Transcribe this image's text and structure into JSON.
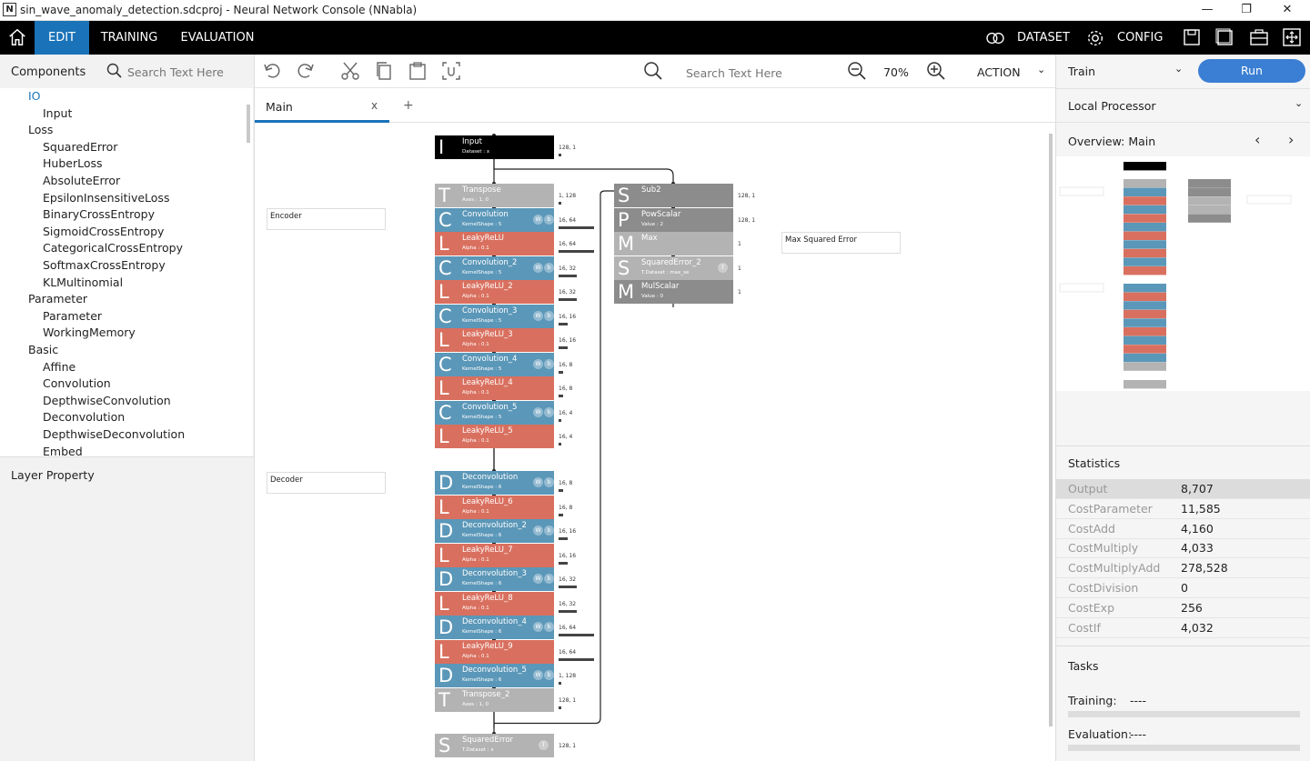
{
  "window": {
    "title": "sin_wave_anomaly_detection.sdcproj - Neural Network Console (NNabla)",
    "app_icon": "N"
  },
  "topbar": {
    "tabs": [
      "EDIT",
      "TRAINING",
      "EVALUATION"
    ],
    "dataset_label": "DATASET",
    "config_label": "CONFIG"
  },
  "left": {
    "components_label": "Components",
    "search_placeholder": "Search Text Here",
    "tree": [
      {
        "label": "IO",
        "level": 0,
        "selected": true
      },
      {
        "label": "Input",
        "level": 1
      },
      {
        "label": "Loss",
        "level": 0
      },
      {
        "label": "SquaredError",
        "level": 1
      },
      {
        "label": "HuberLoss",
        "level": 1
      },
      {
        "label": "AbsoluteError",
        "level": 1
      },
      {
        "label": "EpsilonInsensitiveLoss",
        "level": 1
      },
      {
        "label": "BinaryCrossEntropy",
        "level": 1
      },
      {
        "label": "SigmoidCrossEntropy",
        "level": 1
      },
      {
        "label": "CategoricalCrossEntropy",
        "level": 1
      },
      {
        "label": "SoftmaxCrossEntropy",
        "level": 1
      },
      {
        "label": "KLMultinomial",
        "level": 1
      },
      {
        "label": "Parameter",
        "level": 0
      },
      {
        "label": "Parameter",
        "level": 1
      },
      {
        "label": "WorkingMemory",
        "level": 1
      },
      {
        "label": "Basic",
        "level": 0
      },
      {
        "label": "Affine",
        "level": 1
      },
      {
        "label": "Convolution",
        "level": 1
      },
      {
        "label": "DepthwiseConvolution",
        "level": 1
      },
      {
        "label": "Deconvolution",
        "level": 1
      },
      {
        "label": "DepthwiseDeconvolution",
        "level": 1
      },
      {
        "label": "Embed",
        "level": 1
      }
    ],
    "layer_property_label": "Layer Property"
  },
  "toolbar": {
    "search_placeholder": "Search Text Here",
    "zoom": "70%",
    "action_label": "ACTION"
  },
  "canvas": {
    "tab_main": "Main",
    "tab_close": "x",
    "tab_add": "+",
    "comments": {
      "encoder": "Encoder",
      "decoder": "Decoder",
      "max_se": "Max Squared Error"
    },
    "layers": [
      {
        "icon": "I",
        "name": "Input",
        "param": "Dataset : x",
        "type": "input",
        "size": "128, 1",
        "bar": 0.03
      },
      {
        "icon": "T",
        "name": "Transpose",
        "param": "Axes : 1, 0",
        "type": "gray",
        "size": "1, 128",
        "bar": 0.03
      },
      {
        "icon": "C",
        "name": "Convolution",
        "param": "KernelShape : 5",
        "type": "blue",
        "wb": true,
        "size": "16, 64",
        "bar": 0.6
      },
      {
        "icon": "L",
        "name": "LeakyReLU",
        "param": "Alpha : 0.1",
        "type": "red",
        "size": "16, 64",
        "bar": 0.6
      },
      {
        "icon": "C",
        "name": "Convolution_2",
        "param": "KernelShape : 5",
        "type": "blue",
        "wb": true,
        "size": "16, 32",
        "bar": 0.3
      },
      {
        "icon": "L",
        "name": "LeakyReLU_2",
        "param": "Alpha : 0.1",
        "type": "red",
        "size": "16, 32",
        "bar": 0.3
      },
      {
        "icon": "C",
        "name": "Convolution_3",
        "param": "KernelShape : 5",
        "type": "blue",
        "wb": true,
        "size": "16, 16",
        "bar": 0.15
      },
      {
        "icon": "L",
        "name": "LeakyReLU_3",
        "param": "Alpha : 0.1",
        "type": "red",
        "size": "16, 16",
        "bar": 0.15
      },
      {
        "icon": "C",
        "name": "Convolution_4",
        "param": "KernelShape : 5",
        "type": "blue",
        "wb": true,
        "size": "16, 8",
        "bar": 0.08
      },
      {
        "icon": "L",
        "name": "LeakyReLU_4",
        "param": "Alpha : 0.1",
        "type": "red",
        "size": "16, 8",
        "bar": 0.08
      },
      {
        "icon": "C",
        "name": "Convolution_5",
        "param": "KernelShape : 5",
        "type": "blue",
        "wb": true,
        "size": "16, 4",
        "bar": 0.04
      },
      {
        "icon": "L",
        "name": "LeakyReLU_5",
        "param": "Alpha : 0.1",
        "type": "red",
        "size": "16, 4",
        "bar": 0.04
      },
      {
        "icon": "D",
        "name": "Deconvolution",
        "param": "KernelShape : 6",
        "type": "blue",
        "wb": true,
        "size": "16, 8",
        "bar": 0.08,
        "gap": true
      },
      {
        "icon": "L",
        "name": "LeakyReLU_6",
        "param": "Alpha : 0.1",
        "type": "red",
        "size": "16, 8",
        "bar": 0.08
      },
      {
        "icon": "D",
        "name": "Deconvolution_2",
        "param": "KernelShape : 6",
        "type": "blue",
        "wb": true,
        "size": "16, 16",
        "bar": 0.15
      },
      {
        "icon": "L",
        "name": "LeakyReLU_7",
        "param": "Alpha : 0.1",
        "type": "red",
        "size": "16, 16",
        "bar": 0.15
      },
      {
        "icon": "D",
        "name": "Deconvolution_3",
        "param": "KernelShape : 6",
        "type": "blue",
        "wb": true,
        "size": "16, 32",
        "bar": 0.3
      },
      {
        "icon": "L",
        "name": "LeakyReLU_8",
        "param": "Alpha : 0.1",
        "type": "red",
        "size": "16, 32",
        "bar": 0.3
      },
      {
        "icon": "D",
        "name": "Deconvolution_4",
        "param": "KernelShape : 6",
        "type": "blue",
        "wb": true,
        "size": "16, 64",
        "bar": 0.6
      },
      {
        "icon": "L",
        "name": "LeakyReLU_9",
        "param": "Alpha : 0.1",
        "type": "red",
        "size": "16, 64",
        "bar": 0.6
      },
      {
        "icon": "D",
        "name": "Deconvolution_5",
        "param": "KernelShape : 6",
        "type": "blue",
        "wb": true,
        "size": "1, 128",
        "bar": 0.03
      },
      {
        "icon": "T",
        "name": "Transpose_2",
        "param": "Axes : 1, 0",
        "type": "gray",
        "size": "128, 1",
        "bar": 0.03
      }
    ],
    "loss_layer": {
      "icon": "S",
      "name": "SquaredError",
      "param": "T.Dataset : x",
      "badge": "T",
      "size": "128, 1"
    },
    "side_layers": [
      {
        "icon": "S",
        "name": "Sub2",
        "param": "",
        "type": "dgray",
        "size": "128, 1"
      },
      {
        "icon": "P",
        "name": "PowScalar",
        "param": "Value : 2",
        "type": "dgray",
        "size": "128, 1"
      },
      {
        "icon": "M",
        "name": "Max",
        "param": "",
        "type": "lgray",
        "size": "1"
      },
      {
        "icon": "S",
        "name": "SquaredError_2",
        "param": "T.Dataset : max_se",
        "type": "lgray",
        "badge": "T",
        "size": "1"
      },
      {
        "icon": "M",
        "name": "MulScalar",
        "param": "Value : 0",
        "type": "dgray",
        "size": "1"
      }
    ]
  },
  "right": {
    "mode": "Train",
    "run_label": "Run",
    "processor": "Local Processor",
    "overview_label": "Overview: Main",
    "statistics_label": "Statistics",
    "stats": [
      {
        "k": "Output",
        "v": "8,707",
        "highlight": true
      },
      {
        "k": "CostParameter",
        "v": "11,585"
      },
      {
        "k": "CostAdd",
        "v": "4,160"
      },
      {
        "k": "CostMultiply",
        "v": "4,033"
      },
      {
        "k": "CostMultiplyAdd",
        "v": "278,528"
      },
      {
        "k": "CostDivision",
        "v": "0"
      },
      {
        "k": "CostExp",
        "v": "256"
      },
      {
        "k": "CostIf",
        "v": "4,032"
      }
    ],
    "tasks_label": "Tasks",
    "training_label": "Training:",
    "training_value": "----",
    "evaluation_label": "Evaluation:",
    "evaluation_value": "----"
  },
  "colors": {
    "accent": "#1a73b8",
    "run": "#3b7fd4",
    "blue": "#5b97b8",
    "red": "#d9705f",
    "gray": "#b3b3b3",
    "dgray": "#8c8c8c",
    "input": "#000000"
  }
}
